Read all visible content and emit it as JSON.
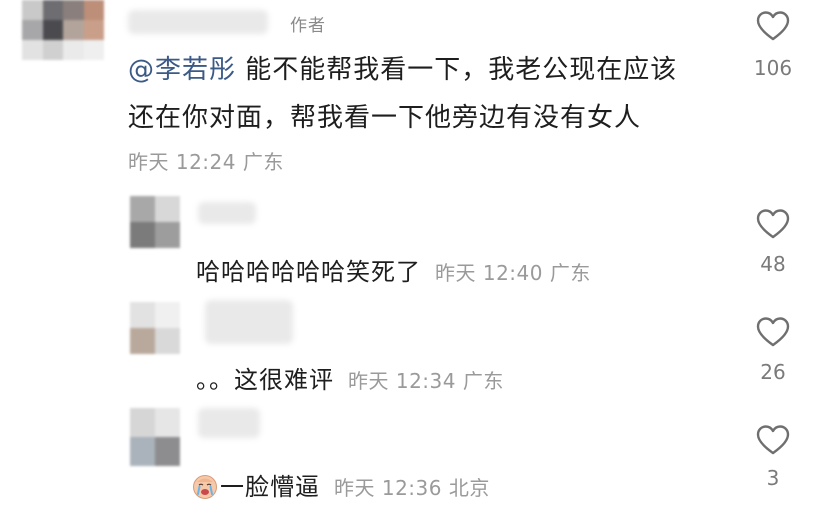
{
  "comment": {
    "author_badge": "作者",
    "mention": "@李若彤",
    "text_line1": " 能不能帮我看一下，我老公现在应该",
    "text_line2": "还在你对面，帮我看一下他旁边有没有女人",
    "meta": "昨天 12:24 广东",
    "likes": "106"
  },
  "replies": [
    {
      "text": "哈哈哈哈哈哈笑死了",
      "meta": "昨天 12:40 广东",
      "likes": "48"
    },
    {
      "text": "。。这很难评",
      "meta": "昨天 12:34 广东",
      "likes": "26"
    },
    {
      "emoji": "crying-baby-emoji",
      "text": "一脸懵逼",
      "meta": "昨天 12:36 北京",
      "likes": "3"
    }
  ],
  "colors": {
    "mention": "#3b5a86",
    "meta": "#9a9a9a",
    "text": "#1e1e1e"
  }
}
